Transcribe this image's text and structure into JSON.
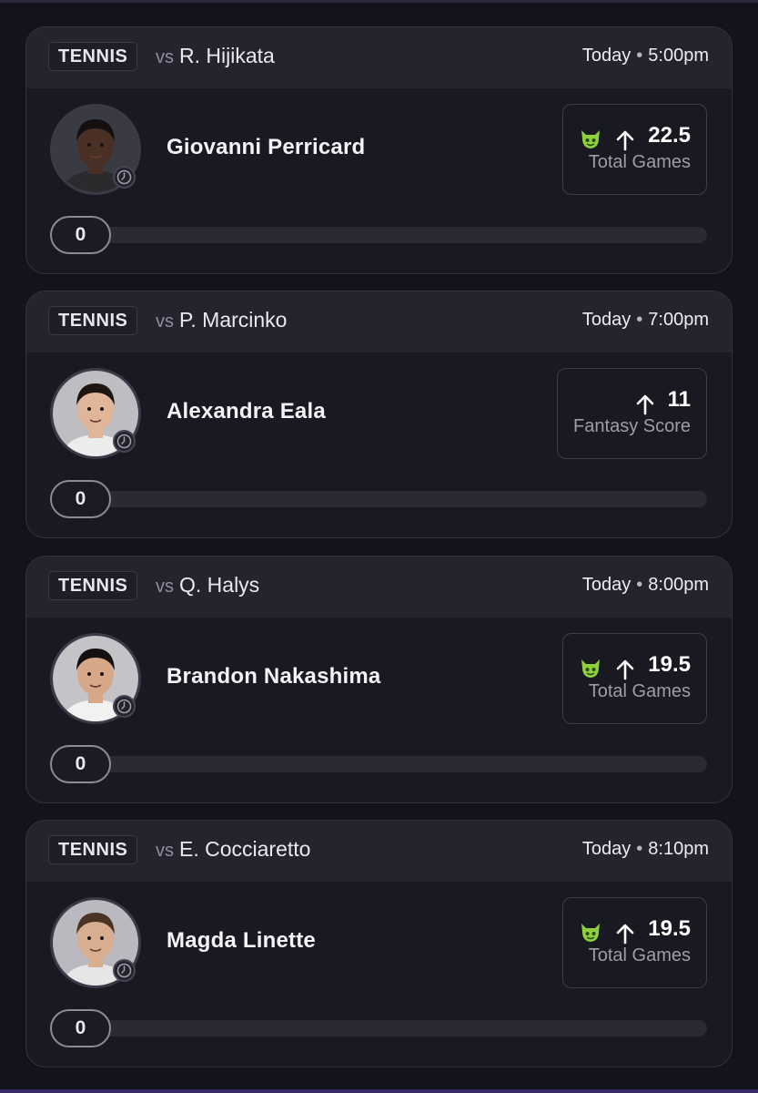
{
  "picks": [
    {
      "sport": "TENNIS",
      "vs_prefix": "vs",
      "opponent": "R. Hijikata",
      "day": "Today",
      "time": "5:00pm",
      "player": "Giovanni Perricard",
      "line_value": "22.5",
      "stat": "Total Games",
      "demon": true,
      "progress_value": "0",
      "avatar": {
        "skin": "#4a2f24",
        "hair": "#151010",
        "shirt": "#2b2b2e",
        "bg": "#3a3a42"
      }
    },
    {
      "sport": "TENNIS",
      "vs_prefix": "vs",
      "opponent": "P. Marcinko",
      "day": "Today",
      "time": "7:00pm",
      "player": "Alexandra Eala",
      "line_value": "11",
      "stat": "Fantasy Score",
      "demon": false,
      "progress_value": "0",
      "avatar": {
        "skin": "#e0b59a",
        "hair": "#1e1410",
        "shirt": "#ececec",
        "bg": "#bdbdc2"
      }
    },
    {
      "sport": "TENNIS",
      "vs_prefix": "vs",
      "opponent": "Q. Halys",
      "day": "Today",
      "time": "8:00pm",
      "player": "Brandon Nakashima",
      "line_value": "19.5",
      "stat": "Total Games",
      "demon": true,
      "progress_value": "0",
      "avatar": {
        "skin": "#d6a888",
        "hair": "#141010",
        "shirt": "#f1f1f1",
        "bg": "#c3c3c8"
      }
    },
    {
      "sport": "TENNIS",
      "vs_prefix": "vs",
      "opponent": "E. Cocciaretto",
      "day": "Today",
      "time": "8:10pm",
      "player": "Magda Linette",
      "line_value": "19.5",
      "stat": "Total Games",
      "demon": true,
      "progress_value": "0",
      "avatar": {
        "skin": "#d9ae90",
        "hair": "#4a3424",
        "shirt": "#e6e6e6",
        "bg": "#b9b9bf"
      }
    }
  ],
  "icons": {
    "demon": "demon-icon",
    "arrow": "arrow-up-icon",
    "clock": "clock-icon"
  },
  "colors": {
    "background": "#13131b",
    "card": "#191921",
    "header": "#24242e",
    "demon_green": "#8ed13c",
    "muted_text": "#9d9daa"
  }
}
